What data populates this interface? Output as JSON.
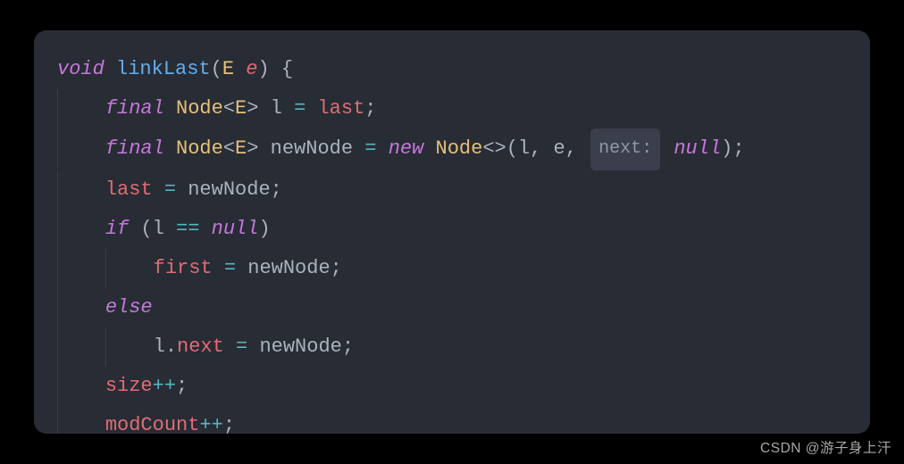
{
  "code": {
    "l1": {
      "void": "void",
      "fn": "linkLast",
      "type_E": "E",
      "param_e": "e"
    },
    "l2": {
      "final": "final",
      "Node": "Node",
      "E": "E",
      "l_var": "l",
      "eq": "=",
      "last": "last"
    },
    "l3": {
      "final": "final",
      "Node": "Node",
      "E": "E",
      "newNode": "newNode",
      "eq": "=",
      "new": "new",
      "Node2": "Node",
      "l_arg": "l",
      "e_arg": "e",
      "hint": "next:",
      "null": "null"
    },
    "l4": {
      "last": "last",
      "eq": "=",
      "newNode": "newNode"
    },
    "l5": {
      "if": "if",
      "l_var": "l",
      "eqeq": "==",
      "null": "null"
    },
    "l6": {
      "first": "first",
      "eq": "=",
      "newNode": "newNode"
    },
    "l7": {
      "else": "else"
    },
    "l8": {
      "l_var": "l",
      "next": "next",
      "eq": "=",
      "newNode": "newNode"
    },
    "l9": {
      "size": "size",
      "pp": "++"
    },
    "l10": {
      "modCount": "modCount",
      "pp": "++"
    }
  },
  "watermark": "CSDN @游子身上汗"
}
